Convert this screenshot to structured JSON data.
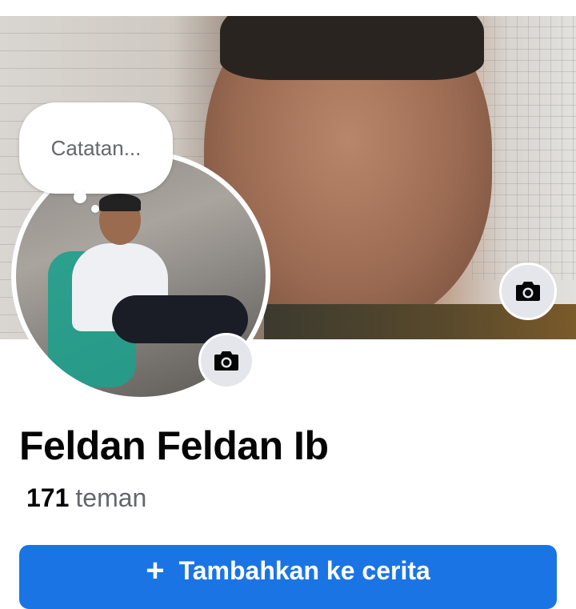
{
  "profile": {
    "name": "Feldan Feldan Ib",
    "friends_count": "171",
    "friends_label": "teman"
  },
  "note_bubble": {
    "placeholder": "Catatan..."
  },
  "actions": {
    "add_story_label": "Tambahkan ke cerita",
    "add_story_icon": "plus-icon"
  },
  "icons": {
    "cover_camera": "camera-icon",
    "profile_camera": "camera-icon"
  },
  "colors": {
    "primary": "#1b74e4",
    "secondary_text": "#65676b",
    "primary_text": "#050505",
    "button_gray": "#e4e6eb"
  }
}
